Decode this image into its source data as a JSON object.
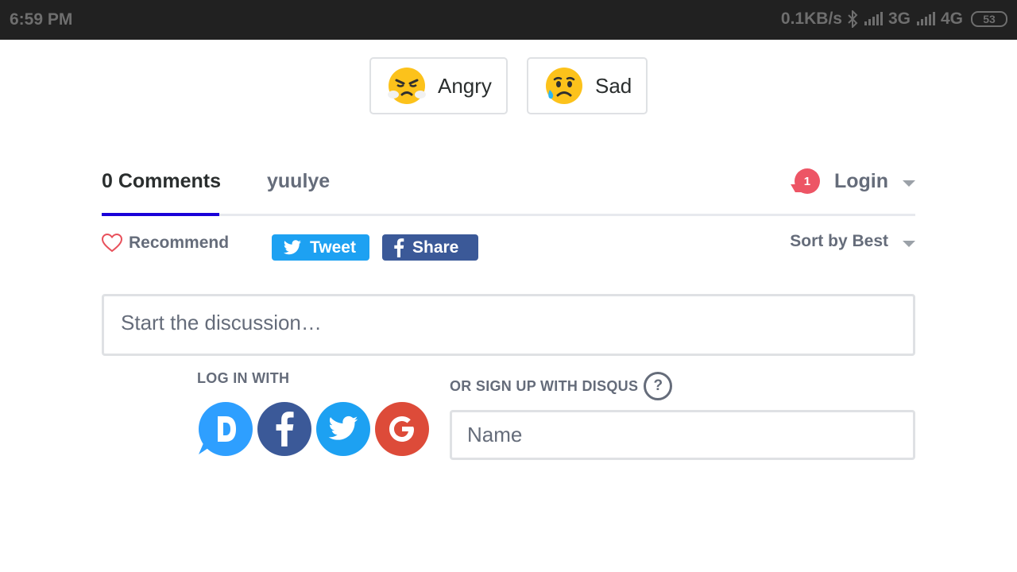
{
  "status_bar": {
    "time": "6:59 PM",
    "speed": "0.1KB/s",
    "net1": "3G",
    "net2": "4G",
    "battery": "53"
  },
  "reactions": [
    {
      "label": "Angry",
      "icon": "angry-face-icon"
    },
    {
      "label": "Sad",
      "icon": "sad-face-icon"
    }
  ],
  "tabs": {
    "comments": "0 Comments",
    "site": "yuulye",
    "notification_count": "1",
    "login": "Login"
  },
  "actions": {
    "recommend": "Recommend",
    "tweet": "Tweet",
    "share": "Share",
    "sort": "Sort by Best"
  },
  "discussion": {
    "placeholder": "Start the discussion…"
  },
  "login_with": {
    "heading": "LOG IN WITH",
    "providers": [
      "disqus",
      "facebook",
      "twitter",
      "google"
    ]
  },
  "signup": {
    "heading": "OR SIGN UP WITH DISQUS",
    "help": "?",
    "name_placeholder": "Name"
  },
  "colors": {
    "active_tab": "#1a00d8",
    "badge": "#ed5565",
    "twitter": "#1da1f2",
    "facebook": "#3b5998",
    "google": "#dd4b39",
    "disqus": "#2e9fff"
  }
}
